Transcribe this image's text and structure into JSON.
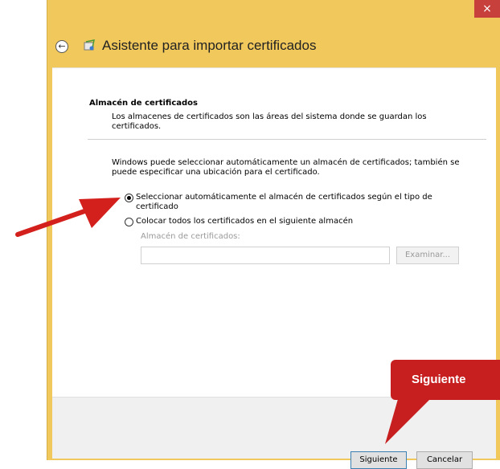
{
  "window": {
    "close_glyph": "×"
  },
  "header": {
    "back_icon": "back-arrow-icon",
    "wizard_icon": "certificate-icon",
    "title": "Asistente para importar certificados"
  },
  "section": {
    "title": "Almacén de certificados",
    "description": "Los almacenes de certificados son las áreas del sistema donde se guardan los certificados."
  },
  "intro": "Windows puede seleccionar automáticamente un almacén de certificados; también se puede especificar una ubicación para el certificado.",
  "options": [
    {
      "label": "Seleccionar automáticamente el almacén de certificados según el tipo de certificado",
      "checked": true
    },
    {
      "label": "Colocar todos los certificados en el siguiente almacén",
      "checked": false
    }
  ],
  "store": {
    "label": "Almacén de certificados:",
    "value": "",
    "browse_label": "Examinar..."
  },
  "buttons": {
    "next": "Siguiente",
    "cancel": "Cancelar"
  },
  "annotation": {
    "callout_text": "Siguiente",
    "color": "#c71f1f"
  }
}
